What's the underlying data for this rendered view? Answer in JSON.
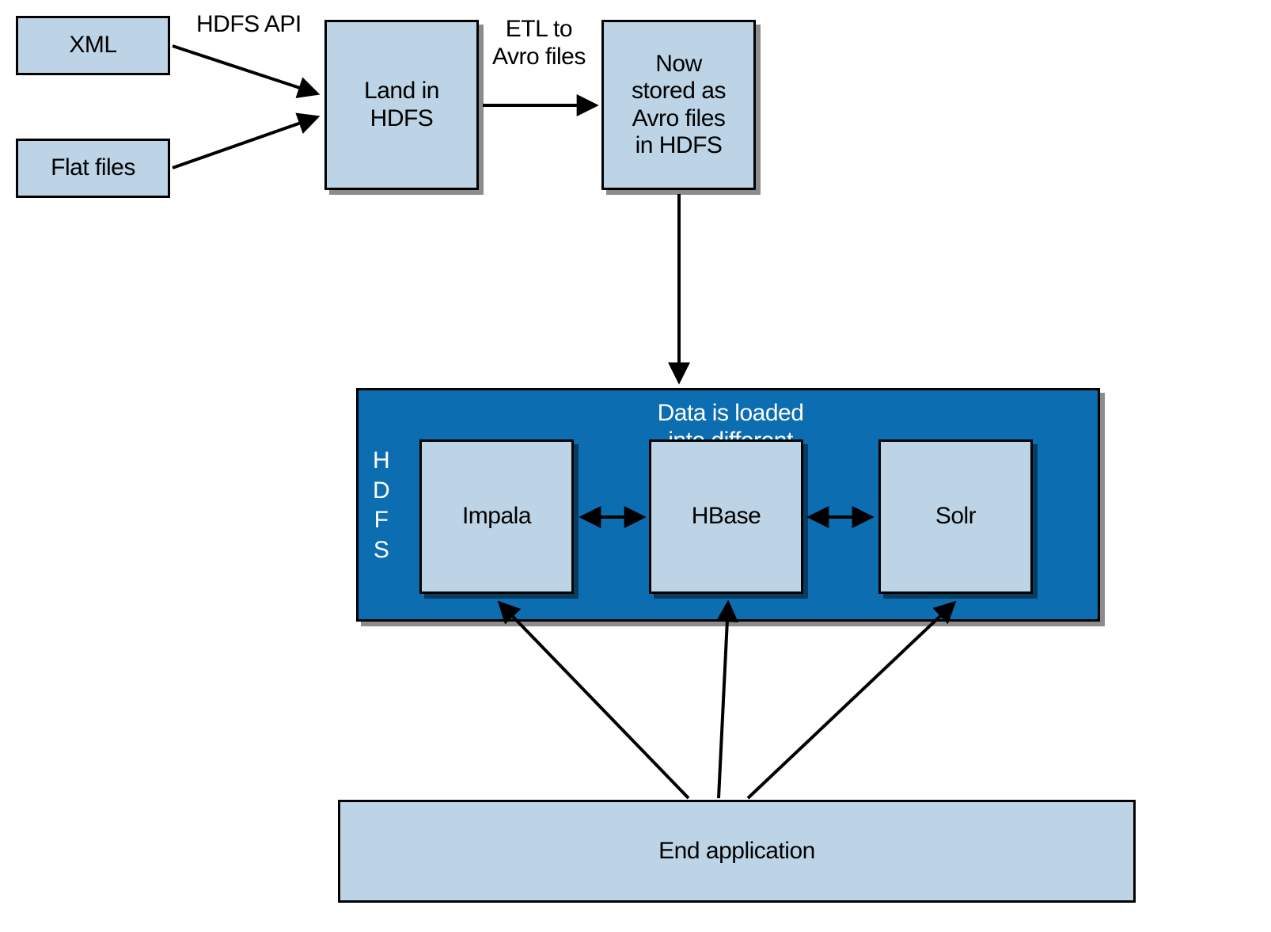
{
  "nodes": {
    "xml": "XML",
    "flat_files": "Flat files",
    "land_hdfs": "Land in\nHDFS",
    "avro_store": "Now\nstored as\nAvro files\nin HDFS",
    "impala": "Impala",
    "hbase": "HBase",
    "solr": "Solr",
    "end_app": "End application"
  },
  "container": {
    "hdfs_vlabel": "H\nD\nF\nS",
    "hdfs_title": "Data is loaded\ninto different\nengines"
  },
  "edge_labels": {
    "hdfs_api": "HDFS API",
    "etl_avro": "ETL to\nAvro files"
  },
  "colors": {
    "box_fill": "#bcd4e6",
    "container_fill": "#0d6db1",
    "stroke": "#000000"
  }
}
